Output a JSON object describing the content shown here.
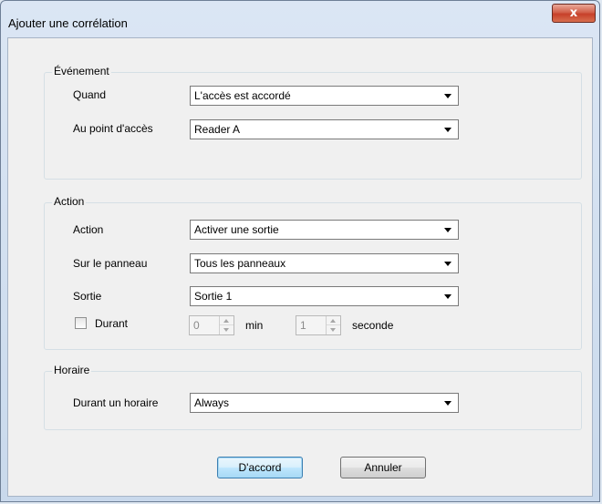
{
  "window": {
    "title": "Ajouter une corrélation",
    "close_glyph": "x"
  },
  "event_group": {
    "legend": "Événement",
    "when_label": "Quand",
    "when_value": "L'accès est accordé",
    "point_label": "Au point d'accès",
    "point_value": "Reader A"
  },
  "action_group": {
    "legend": "Action",
    "action_label": "Action",
    "action_value": "Activer une sortie",
    "panel_label": "Sur le panneau",
    "panel_value": "Tous les panneaux",
    "output_label": "Sortie",
    "output_value": "Sortie 1",
    "duration_label": "Durant",
    "duration_checked": false,
    "minutes_value": "0",
    "minutes_unit": "min",
    "seconds_value": "1",
    "seconds_unit": "seconde"
  },
  "schedule_group": {
    "legend": "Horaire",
    "schedule_label": "Durant un horaire",
    "schedule_value": "Always"
  },
  "buttons": {
    "ok": "D'accord",
    "cancel": "Annuler"
  }
}
